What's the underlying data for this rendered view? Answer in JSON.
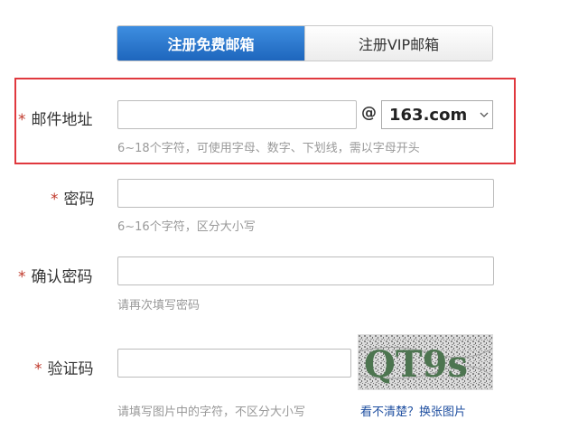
{
  "tabs": [
    {
      "label": "注册免费邮箱",
      "active": true
    },
    {
      "label": "注册VIP邮箱",
      "active": false
    }
  ],
  "required_mark": "*",
  "fields": {
    "email": {
      "label": "邮件地址",
      "value": "",
      "hint": "6~18个字符，可使用字母、数字、下划线，需以字母开头"
    },
    "password": {
      "label": "密码",
      "value": "",
      "hint": "6~16个字符，区分大小写"
    },
    "confirm": {
      "label": "确认密码",
      "value": "",
      "hint": "请再次填写密码"
    },
    "captcha": {
      "label": "验证码",
      "value": "",
      "hint": "请填写图片中的字符，不区分大小写"
    }
  },
  "domain_select": {
    "at": "@",
    "selected": "163.com"
  },
  "captcha_image": {
    "text": "QT9s"
  },
  "refresh_link": "看不清楚？换张图片",
  "colors": {
    "accent": "#1e66bd",
    "required": "#c0392b",
    "highlight": "#e0393e",
    "hint": "#999999",
    "link": "#1f4fa0"
  },
  "icons": {
    "select_arrow": "chevron-down-icon"
  }
}
